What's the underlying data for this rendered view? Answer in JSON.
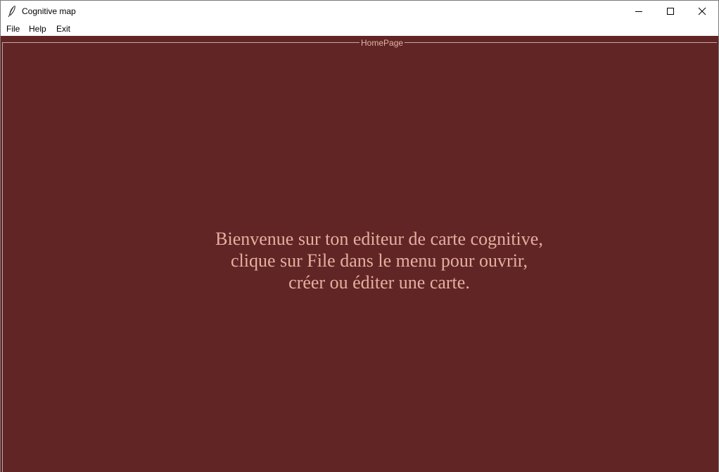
{
  "window": {
    "title": "Cognitive map",
    "icon": "feather-icon",
    "controls": [
      "minimize-icon",
      "maximize-icon",
      "close-icon"
    ]
  },
  "menubar": {
    "items": [
      {
        "label": "File"
      },
      {
        "label": "Help"
      },
      {
        "label": "Exit"
      }
    ]
  },
  "homepage": {
    "frame_label": "HomePage",
    "welcome_lines": [
      "Bienvenue sur ton editeur de carte cognitive,",
      "clique sur File dans le menu pour ouvrir,",
      "créer ou éditer une carte."
    ]
  },
  "colors": {
    "background": "#612526",
    "text": "#e3b09e"
  }
}
